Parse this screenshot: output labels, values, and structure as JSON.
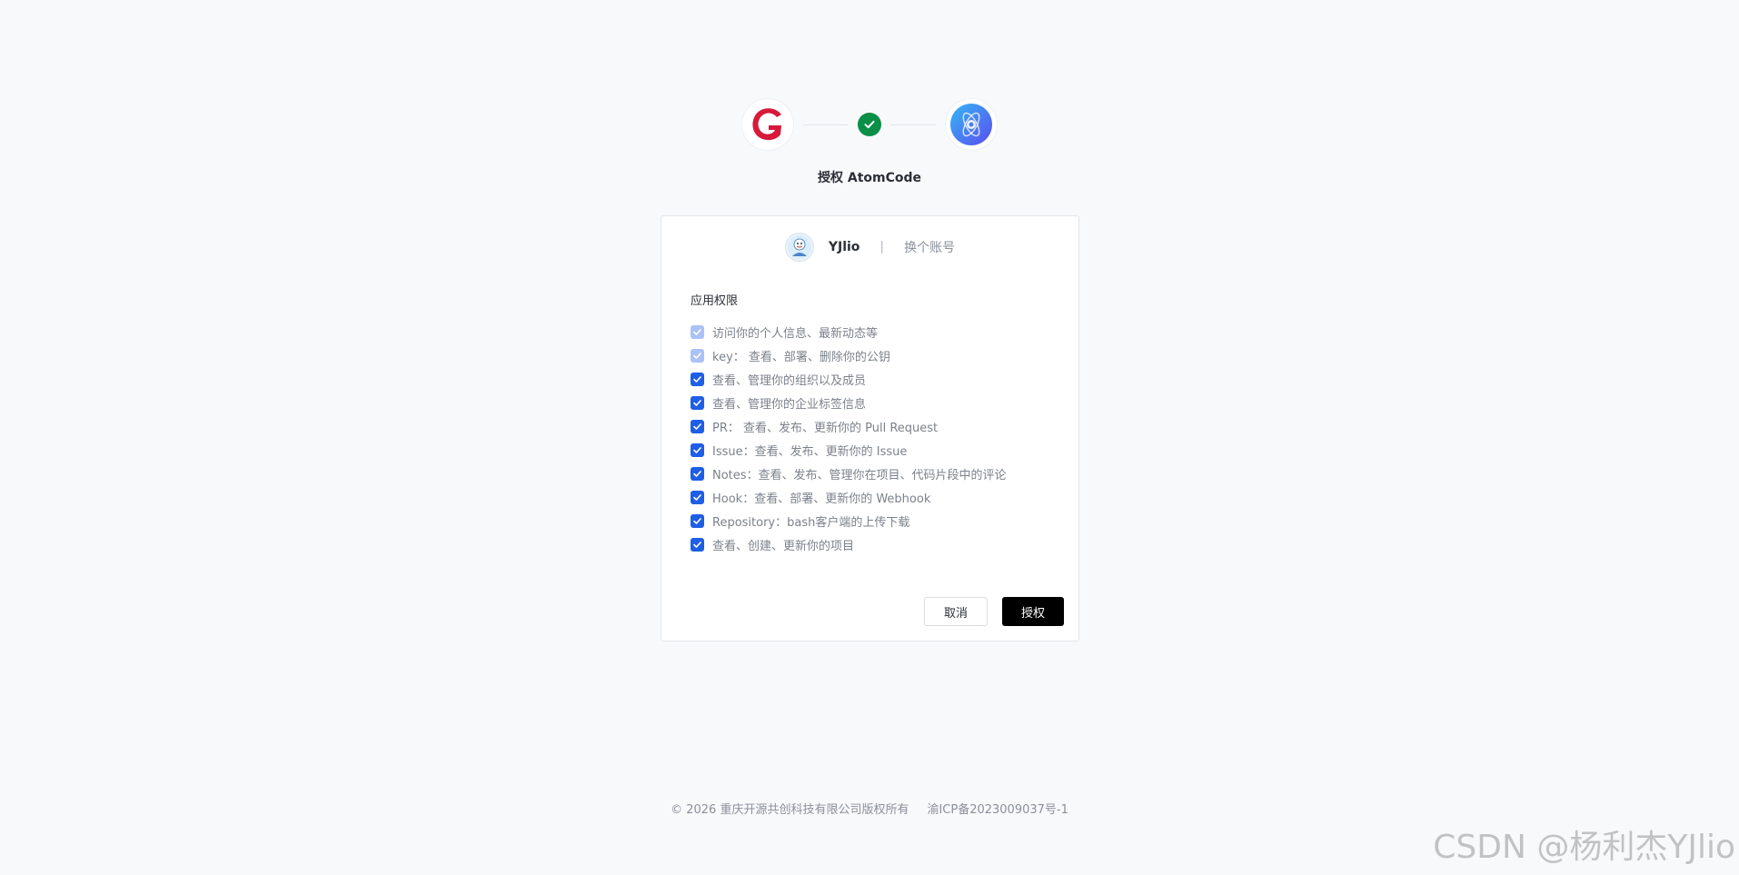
{
  "header": {
    "title": "授权 AtomCode",
    "left_logo": "gitcode-logo",
    "middle_icon": "check-icon",
    "right_logo": "atomcode-logo",
    "colors": {
      "check": "#0a8f46",
      "gitcode": "#d7193a",
      "atomcode": "#2f7cf6"
    }
  },
  "account": {
    "username": "YJlio",
    "separator": "|",
    "switch_label": "换个账号"
  },
  "permissions": {
    "title": "应用权限",
    "items": [
      {
        "label": "访问你的个人信息、最新动态等",
        "checked": true,
        "disabled": true
      },
      {
        "label": "key： 查看、部署、删除你的公钥",
        "checked": true,
        "disabled": true
      },
      {
        "label": "查看、管理你的组织以及成员",
        "checked": true,
        "disabled": false
      },
      {
        "label": "查看、管理你的企业标签信息",
        "checked": true,
        "disabled": false
      },
      {
        "label": "PR： 查看、发布、更新你的 Pull Request",
        "checked": true,
        "disabled": false
      },
      {
        "label": "Issue：查看、发布、更新你的 Issue",
        "checked": true,
        "disabled": false
      },
      {
        "label": "Notes：查看、发布、管理你在项目、代码片段中的评论",
        "checked": true,
        "disabled": false
      },
      {
        "label": "Hook：查看、部署、更新你的 Webhook",
        "checked": true,
        "disabled": false
      },
      {
        "label": "Repository：bash客户端的上传下载",
        "checked": true,
        "disabled": false
      },
      {
        "label": "查看、创建、更新你的项目",
        "checked": true,
        "disabled": false
      }
    ]
  },
  "actions": {
    "cancel_label": "取消",
    "authorize_label": "授权"
  },
  "footer": {
    "copyright": "© 2026 重庆开源共创科技有限公司版权所有",
    "icp": "渝ICP备2023009037号-1"
  },
  "watermark": "CSDN @杨利杰YJlio"
}
